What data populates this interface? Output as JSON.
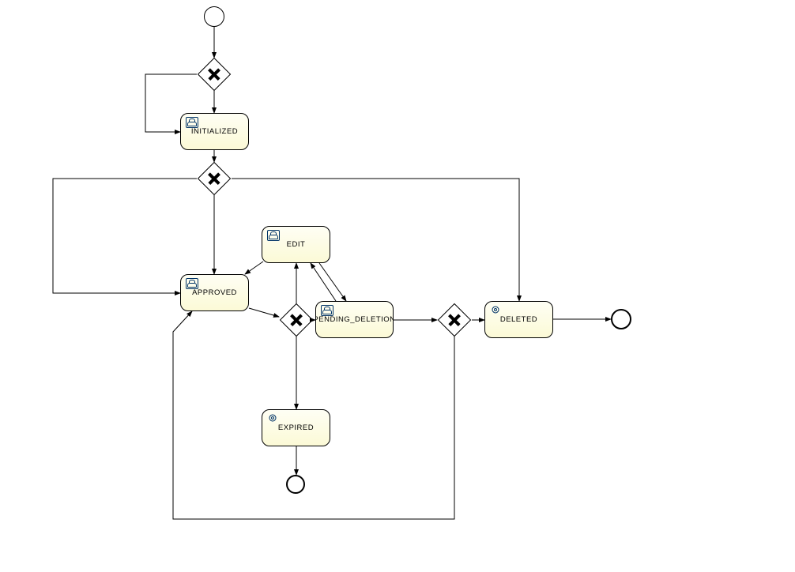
{
  "nodes": {
    "initialized": {
      "label": "INITIALIZED",
      "type": "user"
    },
    "edit": {
      "label": "EDIT",
      "type": "user"
    },
    "approved": {
      "label": "APPROVED",
      "type": "user"
    },
    "pending": {
      "label": "PENDING_DELETION",
      "type": "user"
    },
    "expired": {
      "label": "EXPIRED",
      "type": "service"
    },
    "deleted": {
      "label": "DELETED",
      "type": "service"
    }
  },
  "events": {
    "start": "start-event",
    "end_deleted": "end-event",
    "end_expired": "end-event"
  },
  "gateways": [
    "gw1",
    "gw2",
    "gw3",
    "gw4"
  ],
  "colors": {
    "task_fill_top": "#fefef4",
    "task_fill_bottom": "#fcfad6",
    "stroke": "#000000",
    "icon": "#003366"
  }
}
